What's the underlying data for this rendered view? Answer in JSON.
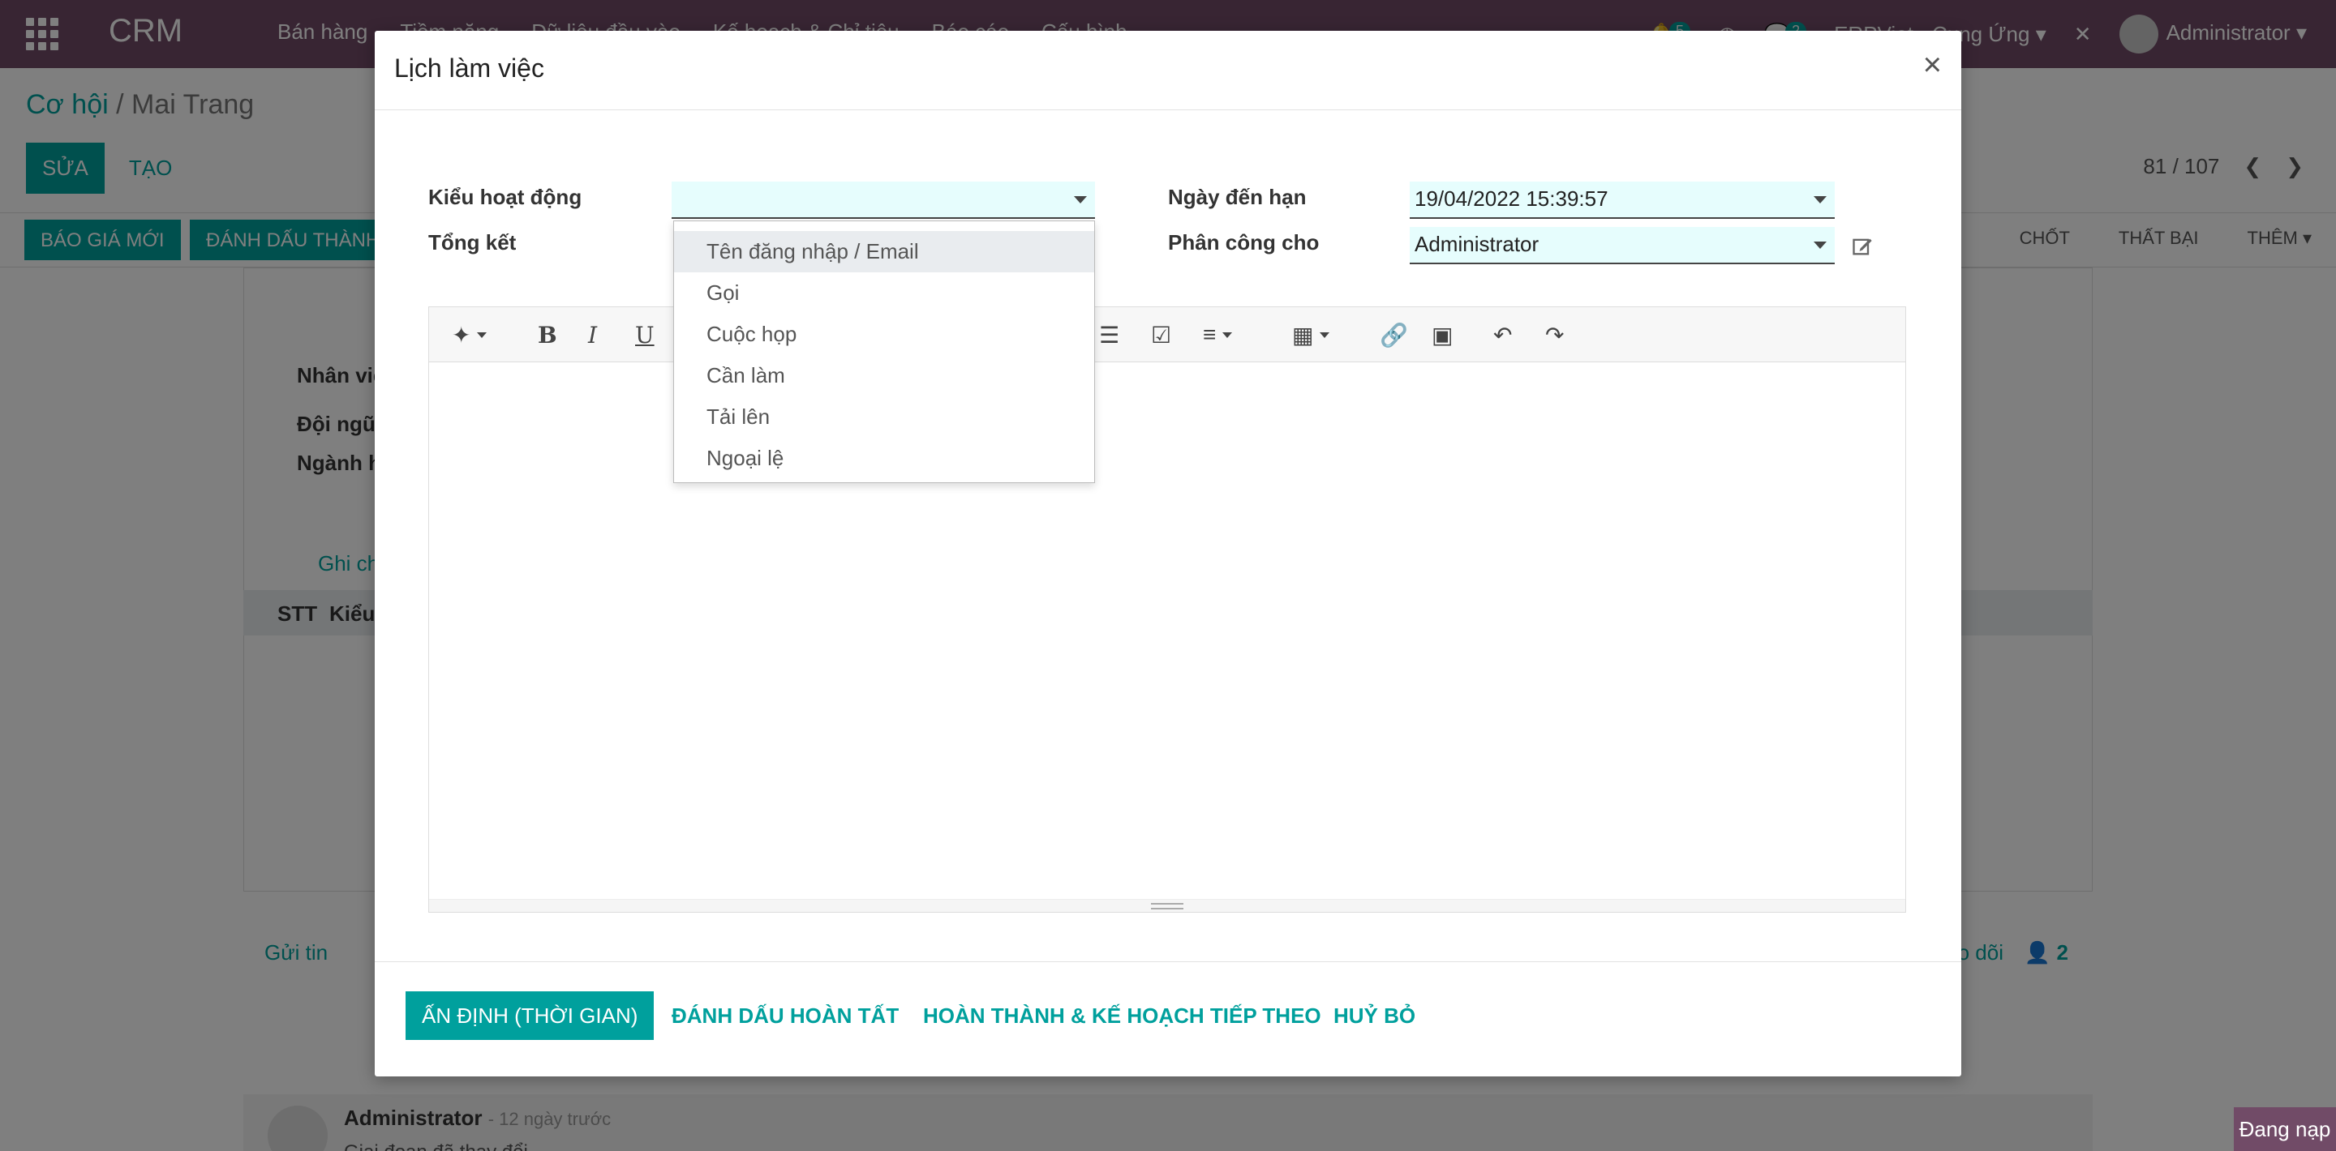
{
  "topnav": {
    "brand": "CRM",
    "menus": [
      "Bán hàng",
      "Tiềm năng",
      "Dữ liệu đầu vào",
      "Kế hoạch & Chỉ tiêu",
      "Báo cáo",
      "Cấu hình"
    ],
    "activity_count": "5",
    "message_count": "2",
    "company": "ERPViet - Cung Ứng",
    "user": "Administrator"
  },
  "breadcrumb": {
    "parent": "Cơ hội",
    "separator": "/",
    "current": "Mai Trang"
  },
  "actions": {
    "edit": "SỬA",
    "create": "TẠO"
  },
  "pager": {
    "value": "81 / 107"
  },
  "statusbar": {
    "quote_button": "BÁO GIÁ MỚI",
    "mark_won_button": "ĐÁNH DẤU THÀNH CÔNG",
    "stages": [
      "CHỐT",
      "THẤT BẠI",
      "THÊM"
    ]
  },
  "background_form": {
    "labels": [
      "Nhân viên",
      "Đội ngũ",
      "Ngành hàng"
    ],
    "internal_note_link": "Ghi chú nội bộ",
    "list_headers": [
      "STT",
      "Kiểu"
    ]
  },
  "chatter": {
    "send_message": "Gửi tin",
    "follow": "Đang theo dõi",
    "followers": "2",
    "author": "Administrator",
    "when": "- 12 ngày trước",
    "text": "Giai đoạn đã thay đổi"
  },
  "modal": {
    "title": "Lịch làm việc",
    "close": "×",
    "activity_type_label": "Kiểu hoạt động",
    "activity_type_value": "",
    "summary_label": "Tổng kết",
    "due_date_label": "Ngày đến hạn",
    "due_date_value": "19/04/2022 15:39:57",
    "assigned_label": "Phân công cho",
    "assigned_value": "Administrator",
    "dropdown_options": [
      "Tên đăng nhập / Email",
      "Gọi",
      "Cuộc họp",
      "Cần làm",
      "Tải lên",
      "Ngoại lệ"
    ],
    "footer": {
      "schedule": "ẤN ĐỊNH (THỜI GIAN)",
      "mark_done": "ĐÁNH DẤU HOÀN TẤT",
      "done_schedule_next": "HOÀN THÀNH & KẾ HOẠCH TIẾP THEO",
      "cancel": "HUỶ BỎ"
    }
  },
  "loading": "Đang nạp",
  "colors": {
    "primary": "#00a09d",
    "navbar": "#714b67",
    "field_bg": "#e6fdfd"
  }
}
